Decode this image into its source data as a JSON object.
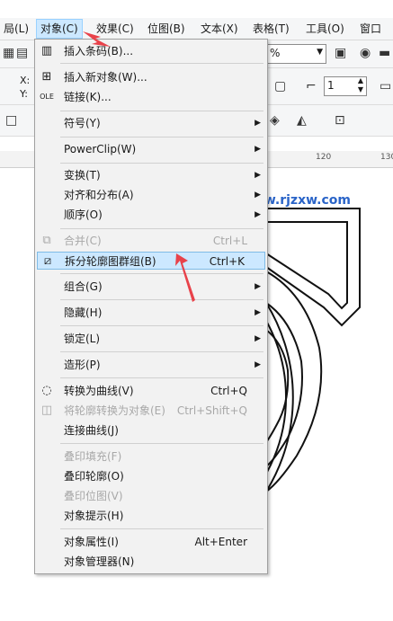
{
  "menubar": {
    "items": [
      "局(L)",
      "对象(C)",
      "效果(C)",
      "位图(B)",
      "文本(X)",
      "表格(T)",
      "工具(O)",
      "窗口"
    ]
  },
  "toolbar": {
    "x_label": "X:",
    "y_label": "Y:",
    "zoom_value": "%",
    "outline_width": "1"
  },
  "ruler": {
    "marks": [
      "120",
      "130"
    ]
  },
  "watermark": "www.rjzxw.com",
  "menu": {
    "items": [
      {
        "label": "插入条码(B)...",
        "shortcut": "",
        "submenu": false,
        "disabled": false,
        "icon": "barcode-icon"
      },
      {
        "label": "插入新对象(W)...",
        "shortcut": "",
        "submenu": false,
        "disabled": false,
        "icon": "insert-object-icon"
      },
      {
        "label": "链接(K)...",
        "shortcut": "",
        "submenu": false,
        "disabled": false,
        "icon": ""
      },
      {
        "label": "符号(Y)",
        "shortcut": "",
        "submenu": true,
        "disabled": false,
        "icon": ""
      },
      {
        "label": "PowerClip(W)",
        "shortcut": "",
        "submenu": true,
        "disabled": false,
        "icon": ""
      },
      {
        "label": "变换(T)",
        "shortcut": "",
        "submenu": true,
        "disabled": false,
        "icon": ""
      },
      {
        "label": "对齐和分布(A)",
        "shortcut": "",
        "submenu": true,
        "disabled": false,
        "icon": ""
      },
      {
        "label": "顺序(O)",
        "shortcut": "",
        "submenu": true,
        "disabled": false,
        "icon": ""
      },
      {
        "label": "合并(C)",
        "shortcut": "Ctrl+L",
        "submenu": false,
        "disabled": true,
        "icon": "combine-icon"
      },
      {
        "label": "拆分轮廓图群组(B)",
        "shortcut": "Ctrl+K",
        "submenu": false,
        "disabled": false,
        "icon": "break-apart-icon"
      },
      {
        "label": "组合(G)",
        "shortcut": "",
        "submenu": true,
        "disabled": false,
        "icon": ""
      },
      {
        "label": "隐藏(H)",
        "shortcut": "",
        "submenu": true,
        "disabled": false,
        "icon": ""
      },
      {
        "label": "锁定(L)",
        "shortcut": "",
        "submenu": true,
        "disabled": false,
        "icon": ""
      },
      {
        "label": "造形(P)",
        "shortcut": "",
        "submenu": true,
        "disabled": false,
        "icon": ""
      },
      {
        "label": "转换为曲线(V)",
        "shortcut": "Ctrl+Q",
        "submenu": false,
        "disabled": false,
        "icon": "convert-curves-icon"
      },
      {
        "label": "将轮廓转换为对象(E)",
        "shortcut": "Ctrl+Shift+Q",
        "submenu": false,
        "disabled": true,
        "icon": "outline-to-object-icon"
      },
      {
        "label": "连接曲线(J)",
        "shortcut": "",
        "submenu": false,
        "disabled": false,
        "icon": ""
      },
      {
        "label": "叠印填充(F)",
        "shortcut": "",
        "submenu": false,
        "disabled": true,
        "icon": ""
      },
      {
        "label": "叠印轮廓(O)",
        "shortcut": "",
        "submenu": false,
        "disabled": false,
        "icon": ""
      },
      {
        "label": "叠印位图(V)",
        "shortcut": "",
        "submenu": false,
        "disabled": true,
        "icon": ""
      },
      {
        "label": "对象提示(H)",
        "shortcut": "",
        "submenu": false,
        "disabled": false,
        "icon": ""
      },
      {
        "label": "对象属性(I)",
        "shortcut": "Alt+Enter",
        "submenu": false,
        "disabled": false,
        "icon": ""
      },
      {
        "label": "对象管理器(N)",
        "shortcut": "",
        "submenu": false,
        "disabled": false,
        "icon": ""
      }
    ]
  },
  "colors": {
    "highlight": "#cce8ff",
    "accent_arrow": "#e8424a"
  }
}
